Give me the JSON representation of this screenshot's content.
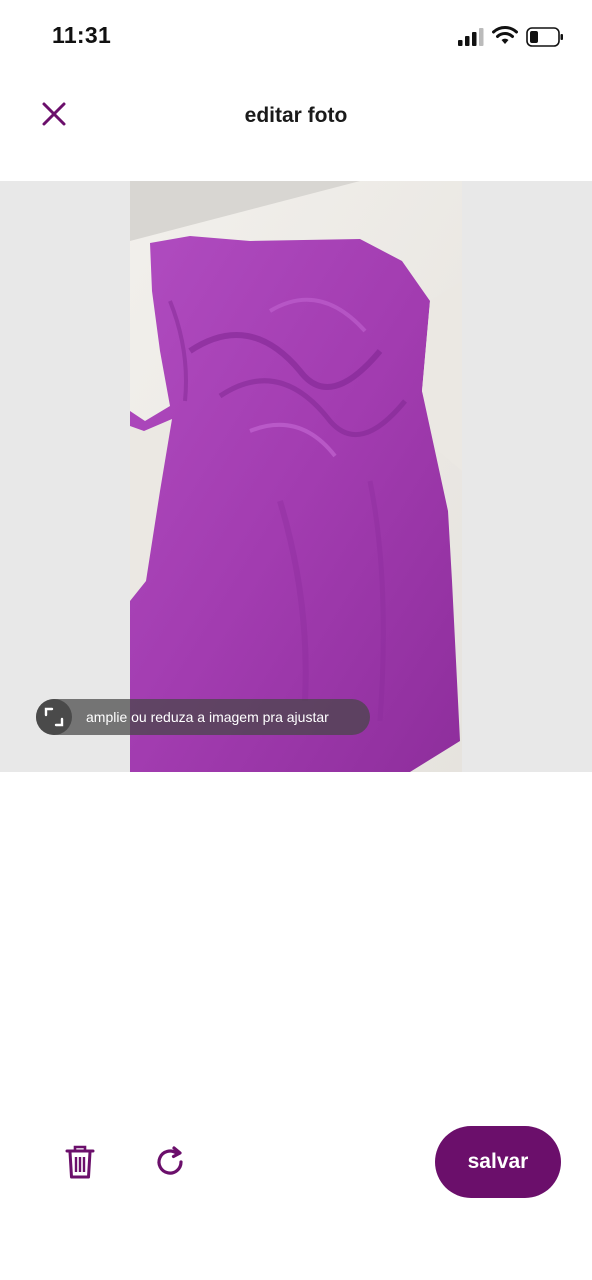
{
  "status_bar": {
    "time": "11:31"
  },
  "header": {
    "title": "editar foto",
    "close_icon": "close-icon"
  },
  "editor": {
    "hint_text": "amplie ou reduza a imagem pra ajustar",
    "hint_icon": "resize-icon",
    "photo_subject": "purple sleeveless cowl-neck top on white sheet"
  },
  "toolbar": {
    "delete_icon": "trash-icon",
    "rotate_icon": "rotate-icon",
    "save_label": "salvar"
  },
  "colors": {
    "accent": "#6b0f6b",
    "garment": "#a23cb0",
    "editor_background": "#e8e8e8"
  }
}
